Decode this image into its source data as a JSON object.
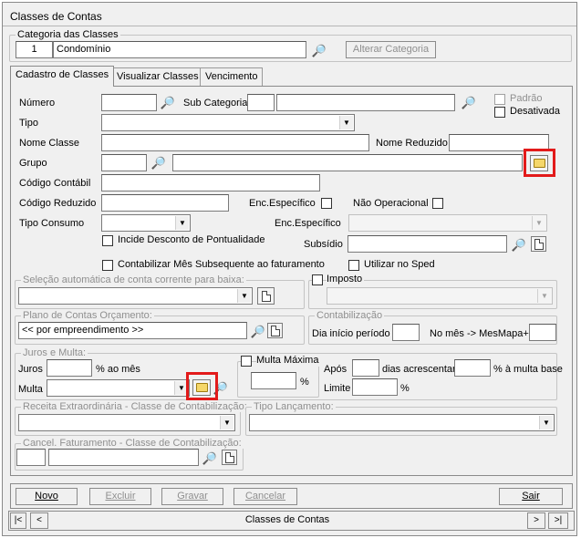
{
  "window": {
    "title": "Classes de Contas"
  },
  "categoria": {
    "legend": "Categoria das Classes",
    "code": "1",
    "name": "Condomínio",
    "alter_button": "Alterar Categoria"
  },
  "tabs": [
    {
      "label": "Cadastro de Classes",
      "active": true
    },
    {
      "label": "Visualizar Classes",
      "active": false
    },
    {
      "label": "Vencimento",
      "active": false
    }
  ],
  "form": {
    "numero_label": "Número",
    "numero_value": "",
    "subcategoria_label": "Sub Categoria",
    "subcategoria_code": "",
    "subcategoria_name": "",
    "padrao_label": "Padrão",
    "desativada_label": "Desativada",
    "tipo_label": "Tipo",
    "tipo_value": "",
    "nome_classe_label": "Nome Classe",
    "nome_classe_value": "",
    "nome_reduzido_label": "Nome Reduzido",
    "nome_reduzido_value": "",
    "grupo_label": "Grupo",
    "grupo_code": "",
    "grupo_name": "",
    "codigo_contabil_label": "Código Contábil",
    "codigo_contabil_value": "",
    "codigo_reduzido_label": "Código Reduzido",
    "codigo_reduzido_value": "",
    "enc_especifico_label": "Enc.Específico",
    "nao_operacional_label": "Não Operacional",
    "tipo_consumo_label": "Tipo Consumo",
    "tipo_consumo_value": "",
    "enc_especifico2_label": "Enc.Específico",
    "enc_especifico2_value": "",
    "incide_desconto_label": "Incide Desconto de Pontualidade",
    "subsidio_label": "Subsídio",
    "subsidio_value": "",
    "contabilizar_label": "Contabilizar Mês Subsequente ao faturamento",
    "utilizar_sped_label": "Utilizar no Sped"
  },
  "selecao": {
    "legend": "Seleção automática de conta corrente para baixa:",
    "value": ""
  },
  "imposto": {
    "label": "Imposto",
    "value": ""
  },
  "plano": {
    "legend": "Plano de Contas Orçamento:",
    "value": "<< por empreendimento >>"
  },
  "contabilizacao": {
    "legend": "Contabilização",
    "dia_label": "Dia início período",
    "dia_value": "",
    "mes_label": "No mês -> MesMapa+",
    "mes_value": ""
  },
  "juros_multa": {
    "legend": "Juros e Multa:",
    "juros_label": "Juros",
    "juros_value": "",
    "ao_mes_label": "% ao mês",
    "multa_label": "Multa",
    "multa_value": "",
    "multa_maxima_label": "Multa Máxima",
    "multa_maxima_value": "",
    "percent_label": "%",
    "apos_label": "Após",
    "apos_value": "",
    "dias_label": "dias acrescentar",
    "dias_value": "",
    "a_multa_base_label": "% à multa base",
    "limite_label": "Limite",
    "limite_value": "",
    "limite_percent": "%"
  },
  "receita": {
    "legend": "Receita Extraordinária - Classe de Contabilização:",
    "value": ""
  },
  "tipo_lancamento": {
    "legend": "Tipo Lançamento:",
    "value": ""
  },
  "cancel": {
    "legend": "Cancel. Faturamento - Classe de Contabilização:",
    "code": "",
    "name": ""
  },
  "buttons": {
    "novo": "Novo",
    "excluir": "Excluir",
    "gravar": "Gravar",
    "cancelar": "Cancelar",
    "sair": "Sair"
  },
  "navigator": {
    "first": "|<",
    "prev": "<",
    "caption": "Classes de Contas",
    "next": ">",
    "last": ">|"
  },
  "colors": {
    "highlight": "#e21a1a",
    "window_bg": "#f0f0f0"
  }
}
